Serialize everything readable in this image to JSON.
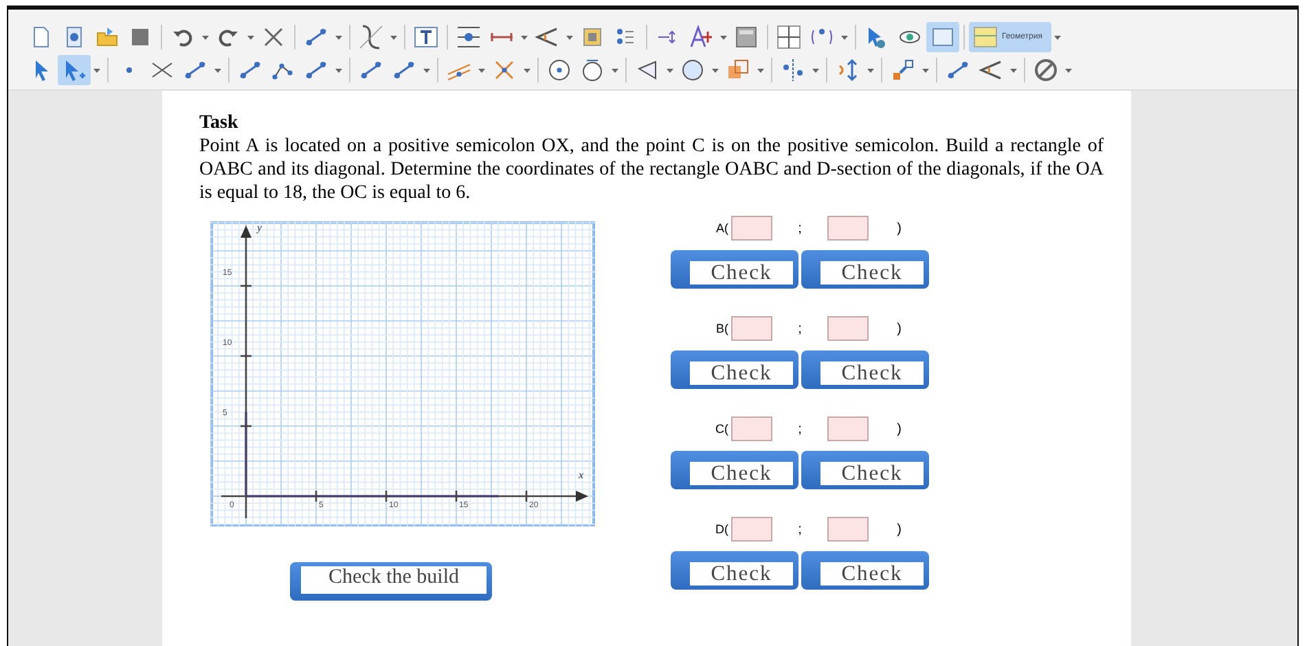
{
  "toolbar": {
    "rows": [
      [
        {
          "selected": false
        },
        {
          "selected": false
        },
        {
          "selected": false
        },
        {
          "selected": false
        },
        {
          "selected": false
        },
        {
          "selected": false
        },
        {
          "selected": false
        },
        {
          "selected": false
        },
        {
          "selected": false
        },
        {
          "selected": false
        },
        {
          "selected": false
        },
        {
          "selected": false
        },
        {
          "selected": false
        },
        {
          "selected": false
        },
        {
          "selected": false
        },
        {
          "selected": false
        },
        {
          "selected": false
        },
        {
          "selected": false
        },
        {
          "selected": false
        },
        {
          "selected": false
        },
        {
          "selected": false
        },
        {
          "selected": false
        },
        {
          "selected": true
        },
        {
          "selected": true
        }
      ],
      [
        {
          "selected": false
        },
        {
          "selected": true
        },
        {
          "selected": false
        },
        {
          "selected": false
        },
        {
          "selected": false
        },
        {
          "selected": false
        },
        {
          "selected": false
        },
        {
          "selected": false
        },
        {
          "selected": false
        },
        {
          "selected": false
        },
        {
          "selected": false
        },
        {
          "selected": false
        },
        {
          "selected": false
        },
        {
          "selected": false
        },
        {
          "selected": false
        },
        {
          "selected": false
        },
        {
          "selected": false
        },
        {
          "selected": false
        },
        {
          "selected": false
        },
        {
          "selected": false
        },
        {
          "selected": false
        },
        {
          "selected": false
        },
        {
          "selected": false
        }
      ]
    ],
    "perspective_label": "Геометрия"
  },
  "task": {
    "title": "Task",
    "text": "Point A is located on a positive semicolon OX, and the point C is on the positive semicolon. Build a rectangle of OABC and its diagonal. Determine the coordinates of the rectangle OABC and D-section of the diagonals, if the OA is equal to 18, the OC is equal to 6."
  },
  "graph": {
    "y_axis": "y",
    "x_axis": "x",
    "origin": "0",
    "x_ticks": [
      "5",
      "10",
      "15",
      "20"
    ],
    "y_ticks": [
      "15",
      "10",
      "5"
    ]
  },
  "build_button": "Check the build",
  "points": [
    {
      "label": "A(",
      "separator": ";",
      "close": ")",
      "buttons": [
        "Check",
        "Check"
      ]
    },
    {
      "label": "B(",
      "separator": ";",
      "close": ")",
      "buttons": [
        "Check",
        "Check"
      ]
    },
    {
      "label": "C(",
      "separator": ";",
      "close": ")",
      "buttons": [
        "Check",
        "Check"
      ]
    },
    {
      "label": "D(",
      "separator": ";",
      "close": ")",
      "buttons": [
        "Check",
        "Check"
      ]
    }
  ]
}
